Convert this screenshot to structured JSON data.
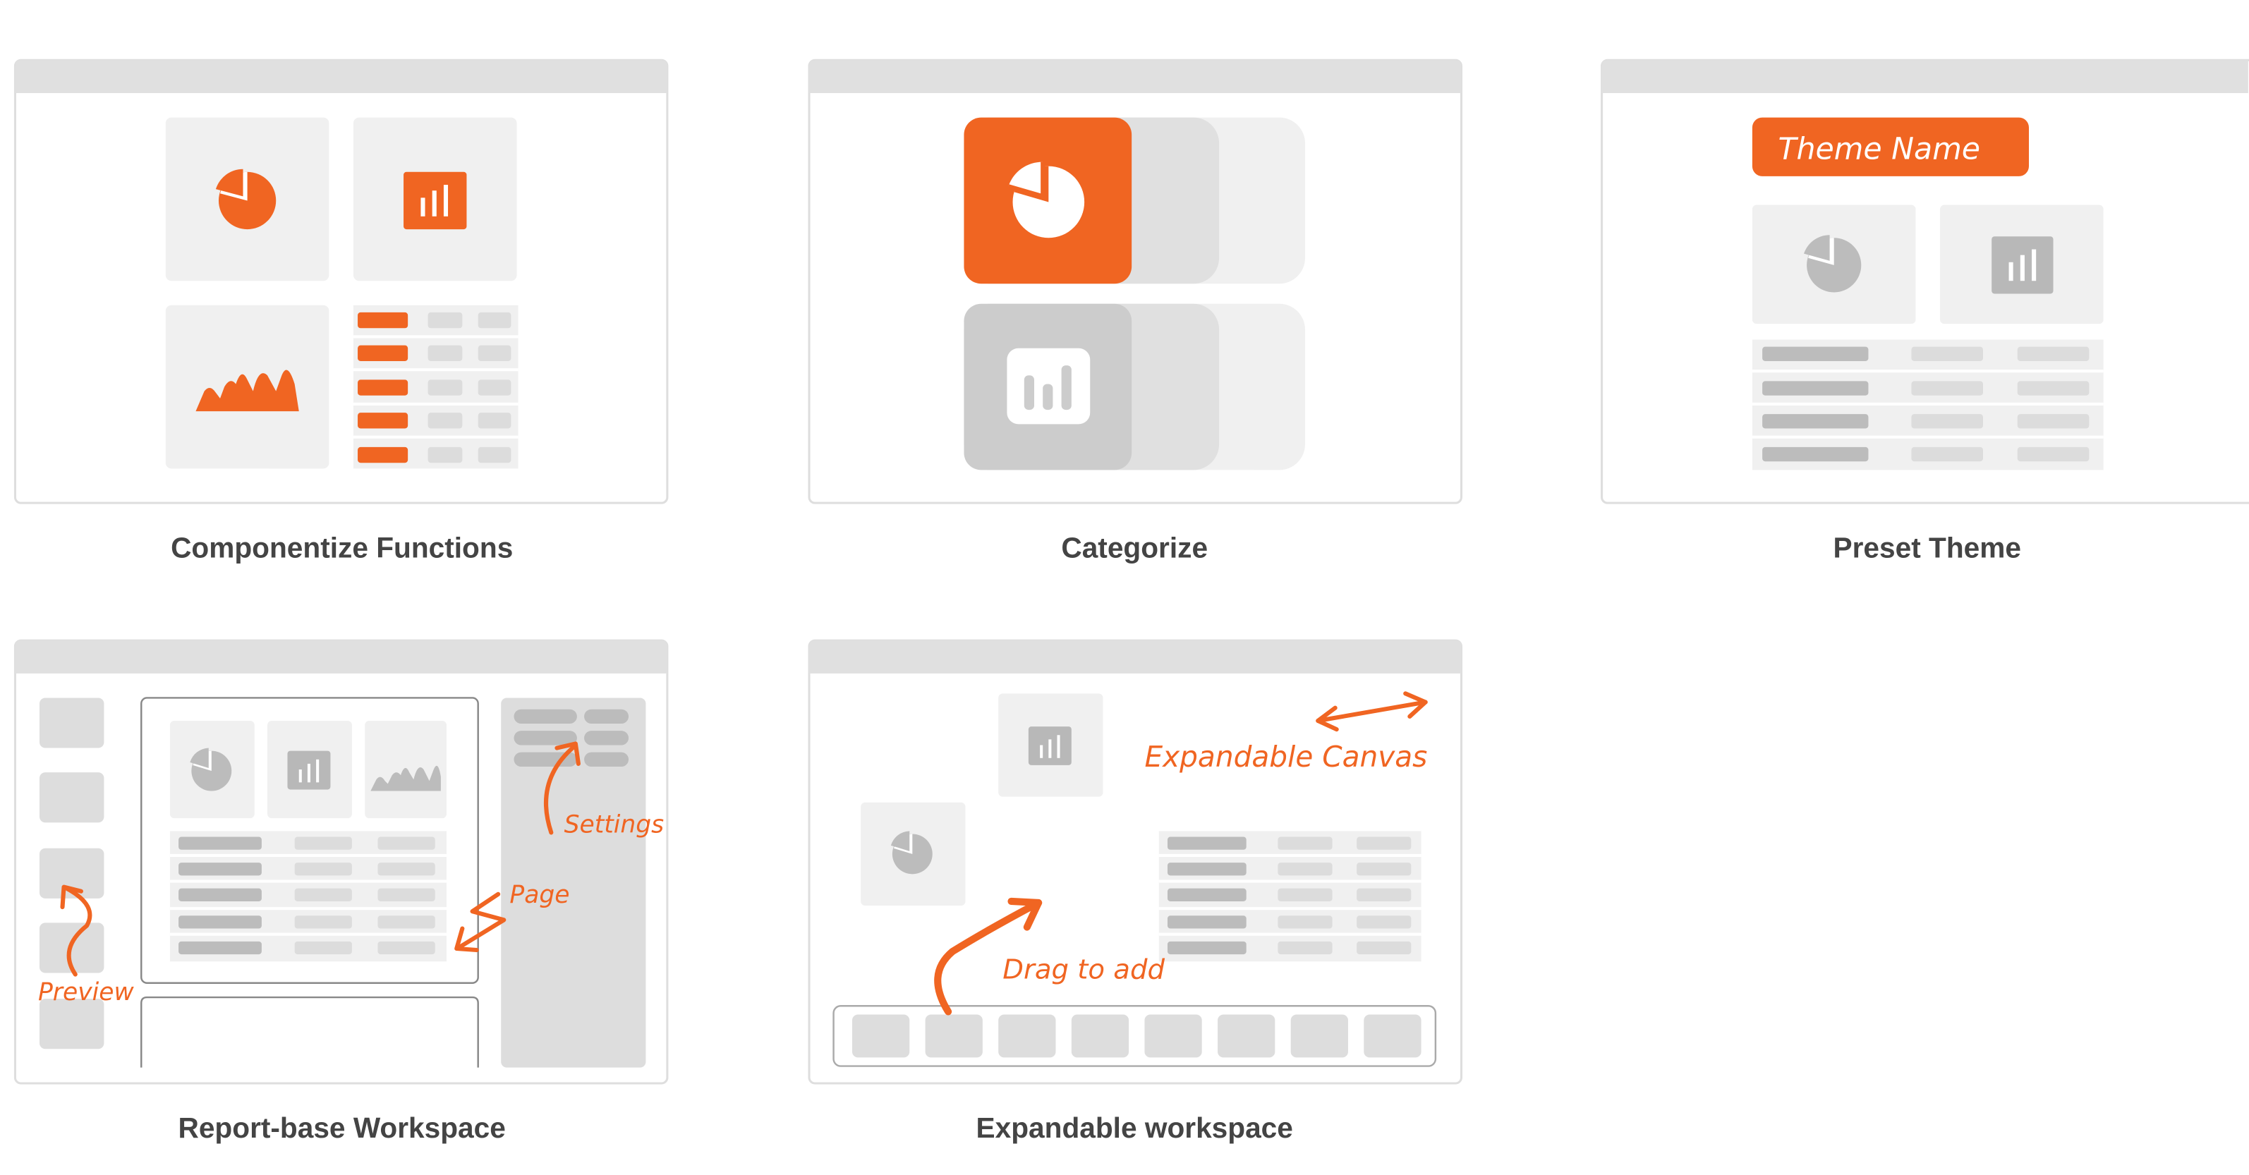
{
  "cards": [
    {
      "caption": "Componentize Functions"
    },
    {
      "caption": "Categorize"
    },
    {
      "caption": "Preset Theme",
      "theme_button": "Theme Name"
    },
    {
      "caption": "Report-base Workspace",
      "annotations": {
        "settings": "Settings",
        "page": "Page",
        "preview": "Preview"
      }
    },
    {
      "caption": "Expandable workspace",
      "annotations": {
        "canvas": "Expandable Canvas",
        "drag": "Drag to add"
      }
    }
  ],
  "colors": {
    "accent": "#f06522",
    "window_frame": "#dcdcdc",
    "window_bar": "#e0e0e0",
    "tile": "#f0f0f0",
    "placeholder": "#c4c4c4",
    "placeholder_light": "#dcdcdc",
    "caption": "#444444"
  },
  "icons": [
    "pie-chart-icon",
    "bar-chart-icon",
    "area-chart-icon",
    "arrow-icon"
  ]
}
